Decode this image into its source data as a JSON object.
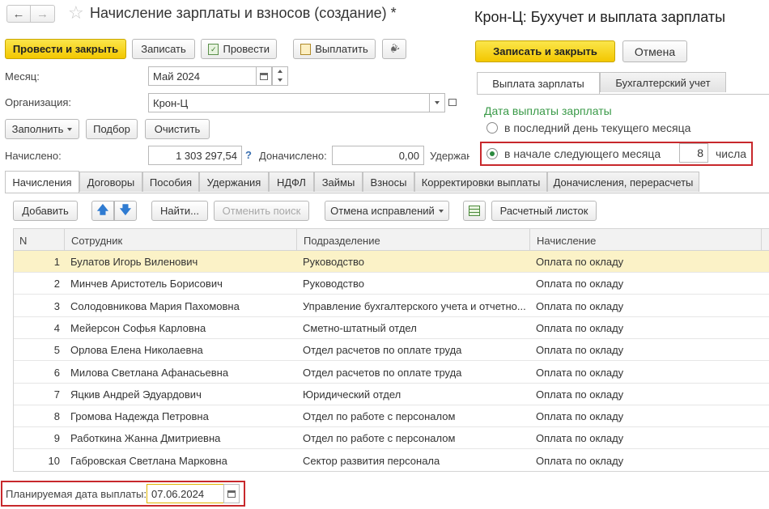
{
  "window": {
    "title": "Начисление зарплаты и взносов (создание) *",
    "right_title": "Крон-Ц: Бухучет и выплата зарплаты"
  },
  "toolbar": {
    "post_close": "Провести и закрыть",
    "save": "Записать",
    "post": "Провести",
    "pay": "Выплатить"
  },
  "form": {
    "month_label": "Месяц:",
    "month_value": "Май 2024",
    "org_label": "Организация:",
    "org_value": "Крон-Ц",
    "fill": "Заполнить",
    "select": "Подбор",
    "clear": "Очистить",
    "accrued_label": "Начислено:",
    "accrued_value": "1 303 297,54",
    "help": "?",
    "extra_label": "Доначислено:",
    "extra_value": "0,00",
    "withheld_label": "Удержан"
  },
  "dialog": {
    "save_close": "Записать и закрыть",
    "cancel": "Отмена",
    "tabs": [
      "Выплата зарплаты",
      "Бухгалтерский учет"
    ],
    "section_title": "Дата выплаты зарплаты",
    "option1": "в последний день текущего месяца",
    "option2": "в начале следующего месяца",
    "day_value": "8",
    "day_suffix": "числа"
  },
  "tabs": [
    "Начисления",
    "Договоры",
    "Пособия",
    "Удержания",
    "НДФЛ",
    "Займы",
    "Взносы",
    "Корректировки выплаты",
    "Доначисления, перерасчеты"
  ],
  "table_toolbar": {
    "add": "Добавить",
    "find": "Найти...",
    "cancel_search": "Отменить поиск",
    "undo_fixes": "Отмена исправлений",
    "payslip": "Расчетный листок"
  },
  "table": {
    "headers": [
      "N",
      "Сотрудник",
      "Подразделение",
      "Начисление"
    ],
    "rows": [
      [
        "1",
        "Булатов Игорь Виленович",
        "Руководство",
        "Оплата по окладу"
      ],
      [
        "2",
        "Минчев Аристотель Борисович",
        "Руководство",
        "Оплата по окладу"
      ],
      [
        "3",
        "Солодовникова Мария Пахомовна",
        "Управление бухгалтерского учета и отчетно...",
        "Оплата по окладу"
      ],
      [
        "4",
        "Мейерсон Софья Карловна",
        "Сметно-штатный отдел",
        "Оплата по окладу"
      ],
      [
        "5",
        "Орлова Елена Николаевна",
        "Отдел расчетов по оплате труда",
        "Оплата по окладу"
      ],
      [
        "6",
        "Милова Светлана Афанасьевна",
        "Отдел расчетов по оплате труда",
        "Оплата по окладу"
      ],
      [
        "7",
        "Яцкив Андрей Эдуардович",
        "Юридический отдел",
        "Оплата по окладу"
      ],
      [
        "8",
        "Громова Надежда Петровна",
        "Отдел по работе с персоналом",
        "Оплата по окладу"
      ],
      [
        "9",
        "Работкина Жанна Дмитриевна",
        "Отдел по работе с персоналом",
        "Оплата по окладу"
      ],
      [
        "10",
        "Габровская Светлана Марковна",
        "Сектор развития персонала",
        "Оплата по окладу"
      ]
    ]
  },
  "footer": {
    "planned_label": "Планируемая дата выплаты:",
    "planned_value": "07.06.2024"
  },
  "colors": {
    "accent_yellow": "#f3c700",
    "selected_row": "#fbf2c7",
    "highlight_red": "#c8282c",
    "section_green": "#3a9a48"
  }
}
